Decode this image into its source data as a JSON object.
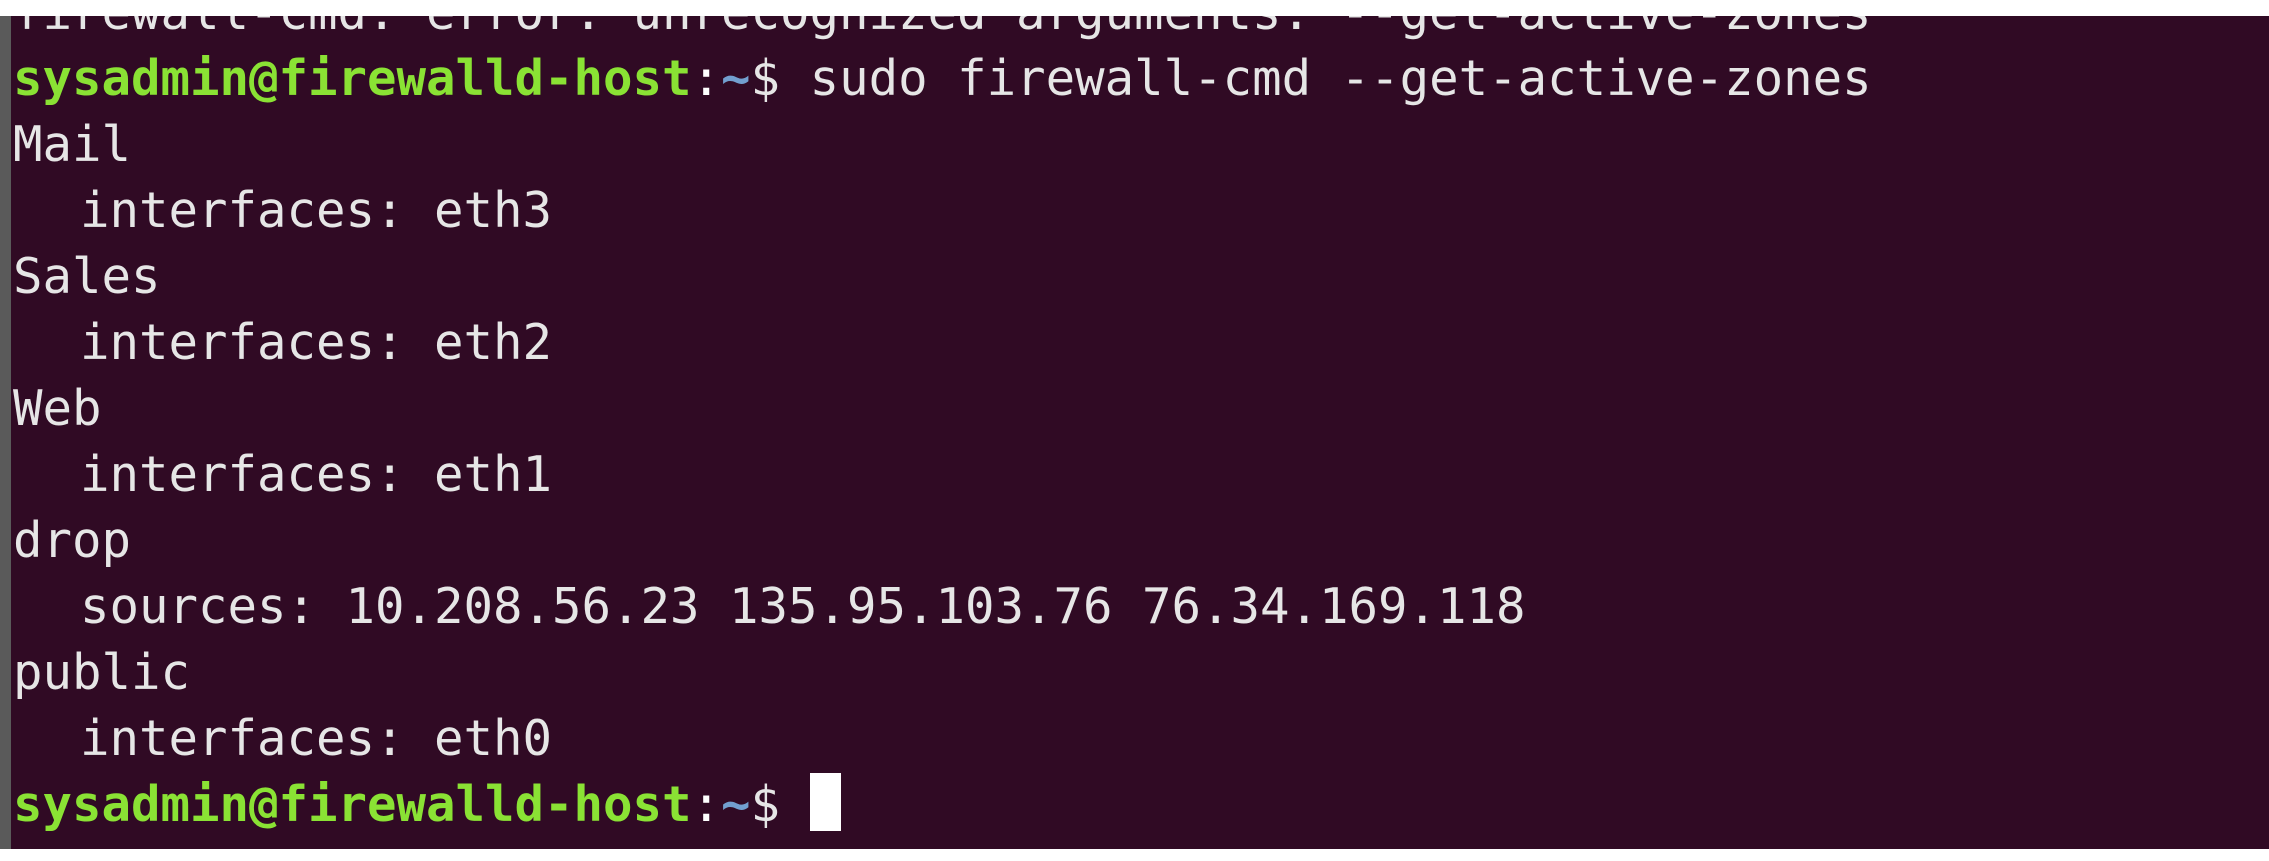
{
  "terminal": {
    "colors": {
      "background": "#300a24",
      "prompt_user": "#8ae234",
      "prompt_path": "#729fcf",
      "text": "#e6e6e6"
    },
    "error_line": "firewall-cmd: error: unrecognized arguments: --get-active-zones",
    "prompt": {
      "user_host": "sysadmin@firewalld-host",
      "separator": ":",
      "path": "~",
      "symbol": "$"
    },
    "command": "sudo firewall-cmd --get-active-zones",
    "output": [
      {
        "zone": "Mail",
        "detail": "interfaces: eth3"
      },
      {
        "zone": "Sales",
        "detail": "interfaces: eth2"
      },
      {
        "zone": "Web",
        "detail": "interfaces: eth1"
      },
      {
        "zone": "drop",
        "detail": "sources: 10.208.56.23 135.95.103.76 76.34.169.118"
      },
      {
        "zone": "public",
        "detail": "interfaces: eth0"
      }
    ]
  }
}
